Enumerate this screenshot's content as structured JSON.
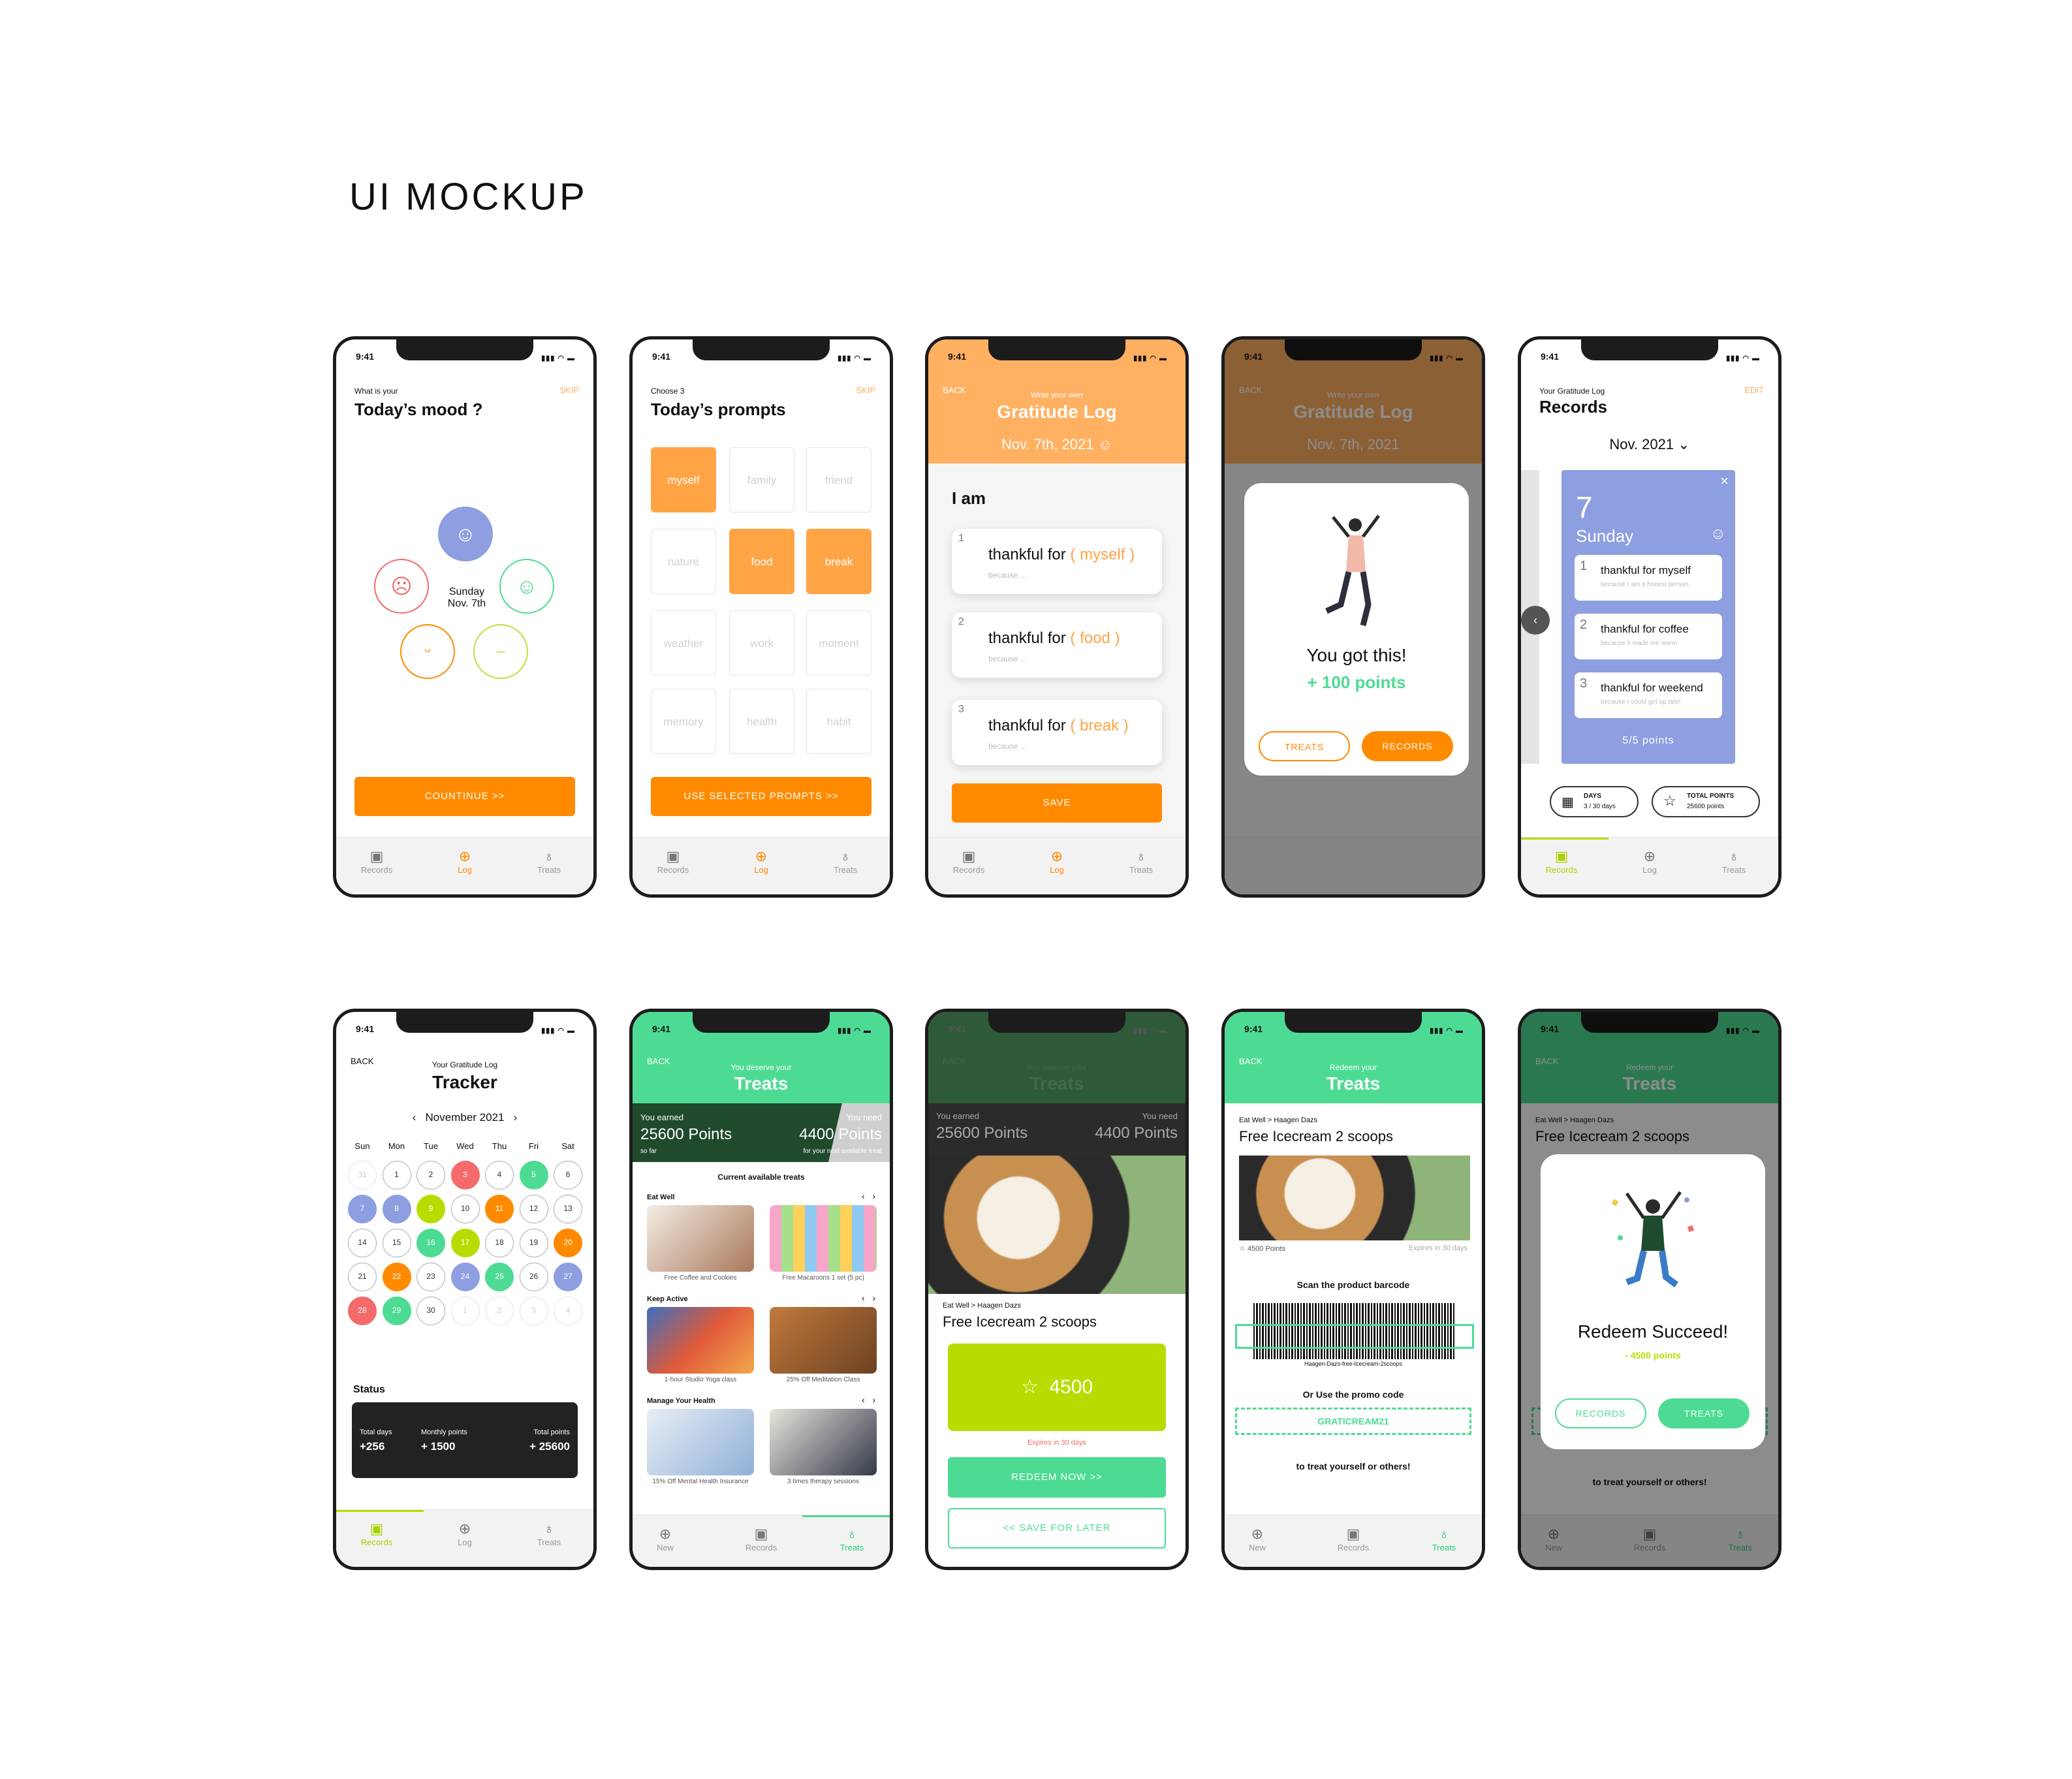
{
  "page_title": "UI MOCKUP",
  "status_time": "9:41",
  "status_icons": "▮▮▮ ◠ ▬",
  "tabs_log": {
    "records": "Records",
    "log": "Log",
    "treats": "Treats"
  },
  "tabs_treats": {
    "new": "New",
    "records": "Records",
    "treats": "Treats"
  },
  "s1": {
    "sub": "What is your",
    "title": "Today’s mood ?",
    "skip": "SKIP",
    "date_day": "Sunday",
    "date": "Nov. 7th",
    "button": "COUNTINUE >>"
  },
  "s2": {
    "sub": "Choose 3",
    "title": "Today’s prompts",
    "skip": "SKIP",
    "prompts": [
      "myself",
      "family",
      "friend",
      "nature",
      "food",
      "break",
      "weather",
      "work",
      "moment",
      "memory",
      "health",
      "habit"
    ],
    "button": "USE SELECTED PROMPTS >>"
  },
  "s3": {
    "back": "BACK",
    "sub": "Write your own",
    "title": "Gratitude Log",
    "date": "Nov. 7th, 2021",
    "heading": "I am",
    "entries": [
      {
        "n": "1",
        "text": "thankful for",
        "tag": "( myself )",
        "hint": "because ..."
      },
      {
        "n": "2",
        "text": "thankful for",
        "tag": "( food )",
        "hint": "because ..."
      },
      {
        "n": "3",
        "text": "thankful for",
        "tag": "( break )",
        "hint": "because ..."
      }
    ],
    "button": "SAVE"
  },
  "s4": {
    "back": "BACK",
    "sub": "Write your own",
    "title": "Gratitude Log",
    "date": "Nov. 7th, 2021",
    "msg": "You got this!",
    "points": "+ 100 points",
    "btn_treats": "TREATS",
    "btn_records": "RECORDS"
  },
  "s5": {
    "sub": "Your Gratitude Log",
    "title": "Records",
    "edit": "EDIT",
    "month": "Nov. 2021",
    "day_num": "7",
    "day_name": "Sunday",
    "entries": [
      {
        "n": "1",
        "text": "thankful for myself",
        "hint": "because I am a honest person"
      },
      {
        "n": "2",
        "text": "thankful for coffee",
        "hint": "because it made me warm"
      },
      {
        "n": "3",
        "text": "thankful for weekend",
        "hint": "because I could get up late!"
      }
    ],
    "score": "5/5 points",
    "days_label": "DAYS",
    "days_val": "3 / 30 days",
    "total_label": "TOTAL POINTS",
    "total_val": "25600 points"
  },
  "s6": {
    "back": "BACK",
    "sub": "Your Gratitude Log",
    "title": "Tracker",
    "month": "November 2021",
    "weekdays": [
      "Sun",
      "Mon",
      "Tue",
      "Wed",
      "Thu",
      "Fri",
      "Sat"
    ],
    "days": [
      "31",
      "1",
      "2",
      "3",
      "4",
      "5",
      "6",
      "7",
      "8",
      "9",
      "10",
      "11",
      "12",
      "13",
      "14",
      "15",
      "16",
      "17",
      "18",
      "19",
      "20",
      "21",
      "22",
      "23",
      "24",
      "25",
      "26",
      "27",
      "28",
      "29",
      "30",
      "1",
      "2",
      "3",
      "4"
    ],
    "status": "Status",
    "total_days_label": "Total days",
    "total_days": "+256",
    "monthly_label": "Monthly points",
    "monthly": "+ 1500",
    "total_points_label": "Total points",
    "total_points": "+ 25600"
  },
  "s7": {
    "back": "BACK",
    "sub": "You deserve your",
    "title": "Treats",
    "earned_label": "You earned",
    "earned": "25600 Points",
    "earned_sub": "so far",
    "need_label": "You need",
    "need": "4400 Points",
    "need_sub": "for your next available treat",
    "current": "Current available treats",
    "cat1": "Eat Well",
    "i1": "Free Coffee and Cookies",
    "i2": "Free Macaroons 1 set (5 pc)",
    "cat2": "Keep Active",
    "i3": "1-hour Studio Yoga class",
    "i4": "25% Off Meditation Class",
    "cat3": "Manage Your Health",
    "i5": "15% Off Mental Health Insurance",
    "i6": "3 times therapy sessions"
  },
  "s8": {
    "back": "BACK",
    "sub": "You deserve your",
    "title": "Treats",
    "earned_label": "You earned",
    "earned": "25600 Points",
    "need_label": "You need",
    "need": "4400 Points",
    "crumb": "Eat Well > Haagen Dazs",
    "item": "Free Icecream 2 scoops",
    "cost": "4500",
    "expires": "Expires in 30 days",
    "redeem": "REDEEM NOW >>",
    "later": "<< SAVE FOR LATER"
  },
  "s9": {
    "back": "BACK",
    "sub": "Redeem your",
    "title": "Treats",
    "crumb": "Eat Well > Haagen Dazs",
    "item": "Free Icecream 2 scoops",
    "points": "4500 Points",
    "expires": "Expires in 30 days",
    "scan": "Scan the product barcode",
    "barcode_text": "Haagen-Dazs-free-Icecream-2scoops",
    "promo_label": "Or Use the promo code",
    "promo": "GRATICREAM21",
    "footer": "to treat yourself or others!"
  },
  "s10": {
    "back": "BACK",
    "sub": "Redeem your",
    "title": "Treats",
    "crumb": "Eat Well > Haagen Dazs",
    "item": "Free Icecream 2 scoops",
    "msg": "Redeem Succeed!",
    "points": "- 4500 points",
    "btn_records": "RECORDS",
    "btn_treats": "TREATS",
    "footer": "to treat yourself or others!"
  },
  "colors": {
    "orange": "#ff8a00",
    "light_orange": "#ffb061",
    "green": "#4ddb93",
    "lime": "#b9dc00",
    "periwinkle": "#8d9fe0",
    "red": "#f56a6a",
    "dark": "#222222"
  }
}
